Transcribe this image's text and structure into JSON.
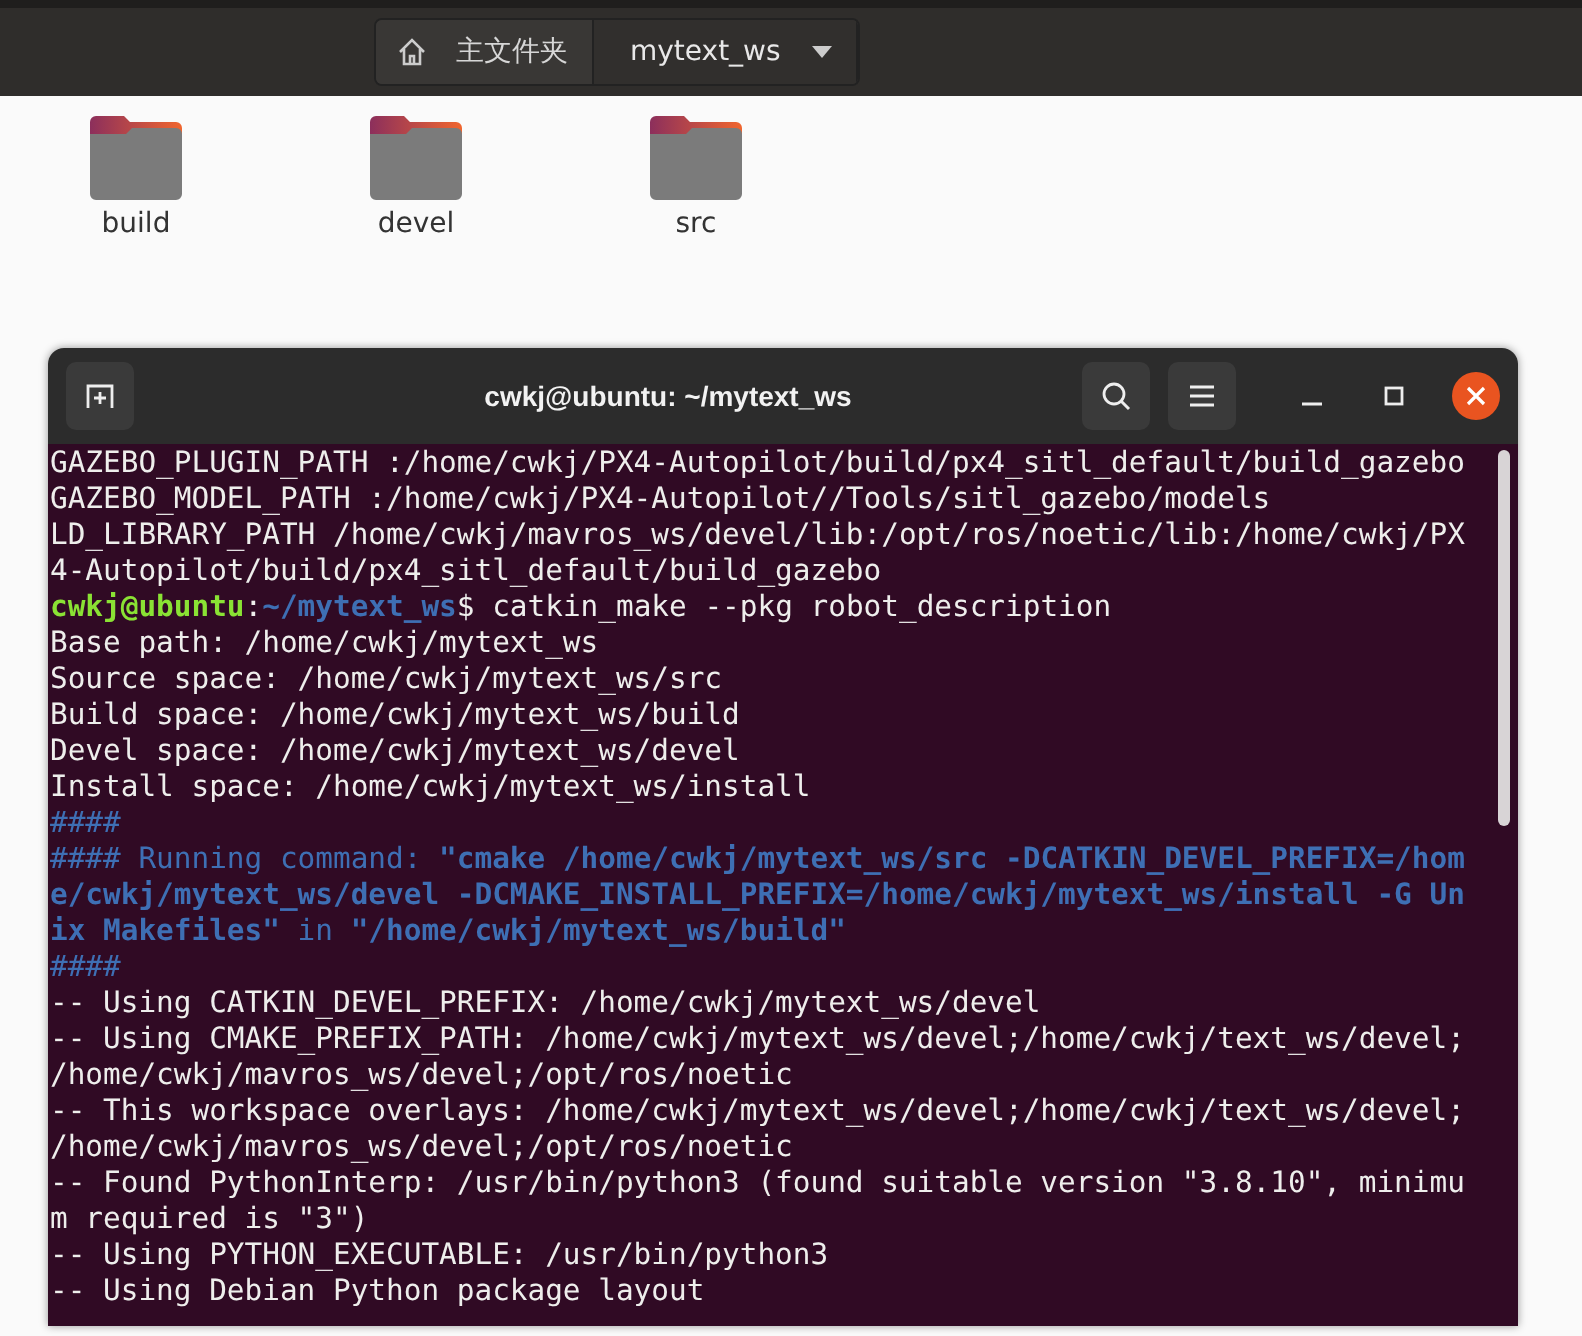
{
  "file_manager": {
    "path_bar": [
      {
        "kind": "home",
        "label": "主文件夹",
        "selected": false
      },
      {
        "kind": "folder",
        "label": "mytext_ws",
        "selected": true
      }
    ],
    "folders": [
      {
        "name": "build"
      },
      {
        "name": "devel"
      },
      {
        "name": "src"
      }
    ]
  },
  "terminal": {
    "title": "cwkj@ubuntu: ~/mytext_ws",
    "lines": [
      [
        {
          "kind": "plain",
          "text": "GAZEBO_PLUGIN_PATH :/home/cwkj/PX4-Autopilot/build/px4_sitl_default/build_gazebo"
        }
      ],
      [
        {
          "kind": "plain",
          "text": "GAZEBO_MODEL_PATH :/home/cwkj/PX4-Autopilot//Tools/sitl_gazebo/models"
        }
      ],
      [
        {
          "kind": "plain",
          "text": "LD_LIBRARY_PATH /home/cwkj/mavros_ws/devel/lib:/opt/ros/noetic/lib:/home/cwkj/PX"
        }
      ],
      [
        {
          "kind": "plain",
          "text": "4-Autopilot/build/px4_sitl_default/build_gazebo"
        }
      ],
      [
        {
          "kind": "user",
          "text": "cwkj@ubuntu"
        },
        {
          "kind": "plain",
          "text": ":"
        },
        {
          "kind": "path",
          "text": "~/mytext_ws"
        },
        {
          "kind": "plain",
          "text": "$ catkin_make --pkg robot_description"
        }
      ],
      [
        {
          "kind": "plain",
          "text": "Base path: /home/cwkj/mytext_ws"
        }
      ],
      [
        {
          "kind": "plain",
          "text": "Source space: /home/cwkj/mytext_ws/src"
        }
      ],
      [
        {
          "kind": "plain",
          "text": "Build space: /home/cwkj/mytext_ws/build"
        }
      ],
      [
        {
          "kind": "plain",
          "text": "Devel space: /home/cwkj/mytext_ws/devel"
        }
      ],
      [
        {
          "kind": "plain",
          "text": "Install space: /home/cwkj/mytext_ws/install"
        }
      ],
      [
        {
          "kind": "comment",
          "text": "####"
        }
      ],
      [
        {
          "kind": "comment",
          "text": "#### Running command: "
        },
        {
          "kind": "path",
          "text": "\"cmake /home/cwkj/mytext_ws/src -DCATKIN_DEVEL_PREFIX=/hom"
        }
      ],
      [
        {
          "kind": "path",
          "text": "e/cwkj/mytext_ws/devel -DCMAKE_INSTALL_PREFIX=/home/cwkj/mytext_ws/install -G Un"
        }
      ],
      [
        {
          "kind": "path",
          "text": "ix Makefiles\""
        },
        {
          "kind": "comment",
          "text": " in "
        },
        {
          "kind": "path",
          "text": "\"/home/cwkj/mytext_ws/build\""
        }
      ],
      [
        {
          "kind": "comment",
          "text": "####"
        }
      ],
      [
        {
          "kind": "plain",
          "text": "-- Using CATKIN_DEVEL_PREFIX: /home/cwkj/mytext_ws/devel"
        }
      ],
      [
        {
          "kind": "plain",
          "text": "-- Using CMAKE_PREFIX_PATH: /home/cwkj/mytext_ws/devel;/home/cwkj/text_ws/devel;"
        }
      ],
      [
        {
          "kind": "plain",
          "text": "/home/cwkj/mavros_ws/devel;/opt/ros/noetic"
        }
      ],
      [
        {
          "kind": "plain",
          "text": "-- This workspace overlays: /home/cwkj/mytext_ws/devel;/home/cwkj/text_ws/devel;"
        }
      ],
      [
        {
          "kind": "plain",
          "text": "/home/cwkj/mavros_ws/devel;/opt/ros/noetic"
        }
      ],
      [
        {
          "kind": "plain",
          "text": "-- Found PythonInterp: /usr/bin/python3 (found suitable version \"3.8.10\", minimu"
        }
      ],
      [
        {
          "kind": "plain",
          "text": "m required is \"3\")"
        }
      ],
      [
        {
          "kind": "plain",
          "text": "-- Using PYTHON_EXECUTABLE: /usr/bin/python3"
        }
      ],
      [
        {
          "kind": "plain",
          "text": "-- Using Debian Python package layout"
        }
      ]
    ]
  }
}
